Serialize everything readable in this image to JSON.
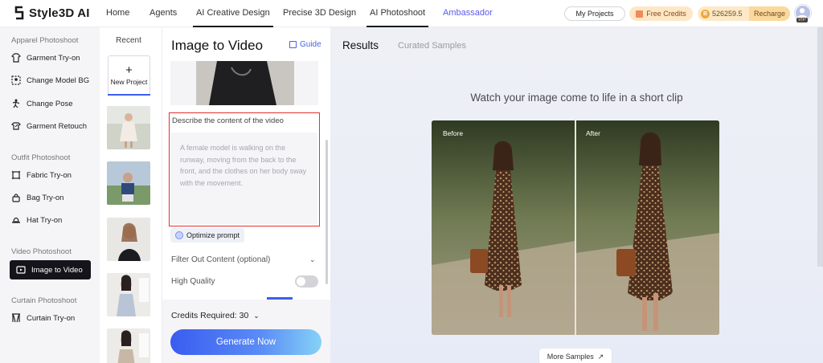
{
  "brand": {
    "name": "Style3D AI"
  },
  "nav": {
    "items": [
      {
        "label": "Home"
      },
      {
        "label": "Agents"
      },
      {
        "label": "AI Creative Design"
      },
      {
        "label": "Precise 3D Design"
      },
      {
        "label": "AI Photoshoot"
      },
      {
        "label": "Ambassador"
      }
    ],
    "my_projects": "My Projects",
    "free_credits": "Free Credits",
    "coin_symbol": "B",
    "credits_balance": "526259.5",
    "recharge": "Recharge",
    "vip_badge": "VIP"
  },
  "sidebar": {
    "groups": [
      {
        "title": "Apparel Photoshoot",
        "items": [
          {
            "label": "Garment Try-on",
            "icon": "garment-icon"
          },
          {
            "label": "Change Model BG",
            "icon": "background-icon"
          },
          {
            "label": "Change Pose",
            "icon": "pose-icon"
          },
          {
            "label": "Garment Retouch",
            "icon": "retouch-icon"
          }
        ]
      },
      {
        "title": "Outfit Photoshoot",
        "items": [
          {
            "label": "Fabric Try-on",
            "icon": "fabric-icon"
          },
          {
            "label": "Bag Try-on",
            "icon": "bag-icon"
          },
          {
            "label": "Hat Try-on",
            "icon": "hat-icon"
          }
        ]
      },
      {
        "title": "Video Photoshoot",
        "items": [
          {
            "label": "Image to Video",
            "icon": "video-icon",
            "active": true
          }
        ]
      },
      {
        "title": "Curtain Photoshoot",
        "items": [
          {
            "label": "Curtain Try-on",
            "icon": "curtain-icon"
          }
        ]
      }
    ]
  },
  "recent": {
    "title": "Recent",
    "new_project": "New Project"
  },
  "panel": {
    "title": "Image to Video",
    "guide": "Guide",
    "describe_label": "Describe the content of the video",
    "describe_placeholder": "A female model is walking on the runway, moving from the back to the front, and the clothes on her body sway with the movement.",
    "optimize": "Optimize prompt",
    "filter_label": "Filter Out Content (optional)",
    "high_quality": "High Quality",
    "credits_required": "Credits Required: 30",
    "generate": "Generate Now"
  },
  "results": {
    "tab_results": "Results",
    "tab_curated": "Curated Samples",
    "subtitle": "Watch your image come to life in a short clip",
    "before": "Before",
    "after": "After",
    "more_samples": "More Samples"
  }
}
